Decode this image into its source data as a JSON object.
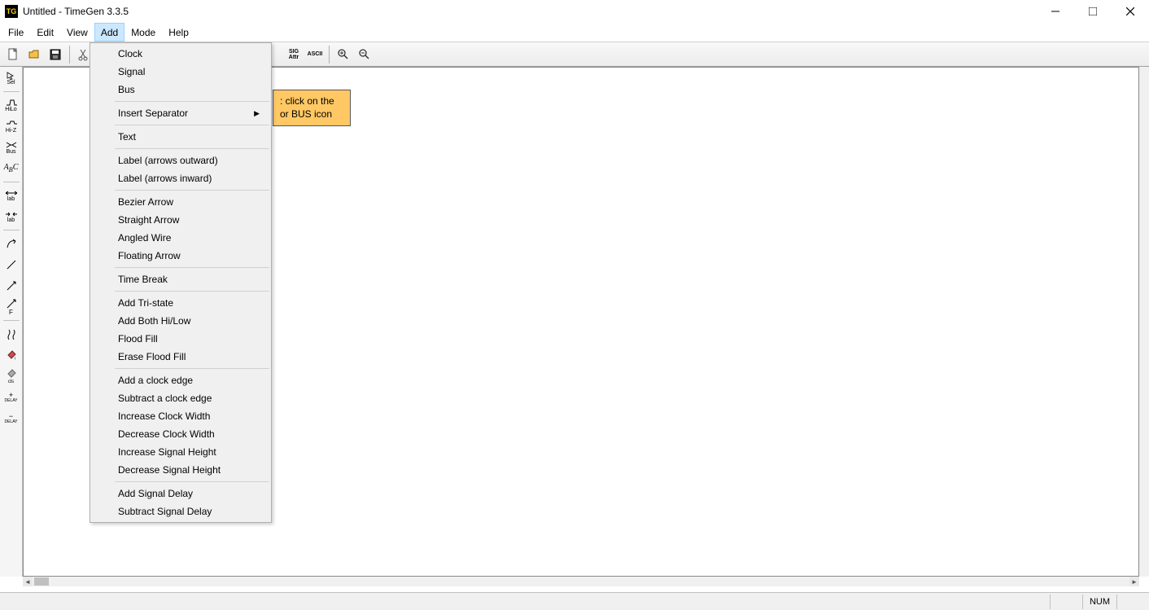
{
  "window": {
    "title": "Untitled - TimeGen 3.3.5",
    "app_icon_text": "TG"
  },
  "menubar": {
    "file": "File",
    "edit": "Edit",
    "view": "View",
    "add": "Add",
    "mode": "Mode",
    "help": "Help"
  },
  "dropdown": {
    "clock": "Clock",
    "signal": "Signal",
    "bus": "Bus",
    "insert_separator": "Insert Separator",
    "text": "Text",
    "label_out": "Label (arrows outward)",
    "label_in": "Label (arrows inward)",
    "bezier_arrow": "Bezier Arrow",
    "straight_arrow": "Straight Arrow",
    "angled_wire": "Angled Wire",
    "floating_arrow": "Floating Arrow",
    "time_break": "Time Break",
    "add_tristate": "Add Tri-state",
    "add_both_hilow": "Add Both Hi/Low",
    "flood_fill": "Flood Fill",
    "erase_flood_fill": "Erase Flood Fill",
    "add_clock_edge": "Add a clock edge",
    "subtract_clock_edge": "Subtract a clock edge",
    "increase_clock_width": "Increase Clock Width",
    "decrease_clock_width": "Decrease Clock Width",
    "increase_signal_height": "Increase Signal Height",
    "decrease_signal_height": "Decrease Signal Height",
    "add_signal_delay": "Add Signal Delay",
    "subtract_signal_delay": "Subtract Signal Delay"
  },
  "hint": {
    "line1": ": click on the",
    "line2": " or BUS icon"
  },
  "toolbar_icons": {
    "sig_attr_top": "SIG",
    "sig_attr_bottom": "Attr",
    "ascii": "ASCII"
  },
  "left_palette": {
    "sel": "Sel",
    "hilo": "HiLo",
    "hiz": "Hi-Z",
    "bus": "Bus",
    "abc": "ABC",
    "lab1": "lab",
    "lab2": "lab",
    "f": "F",
    "cls": "cls",
    "delay_plus": "DELAY",
    "delay_minus": "DELAY"
  },
  "statusbar": {
    "num": "NUM"
  }
}
